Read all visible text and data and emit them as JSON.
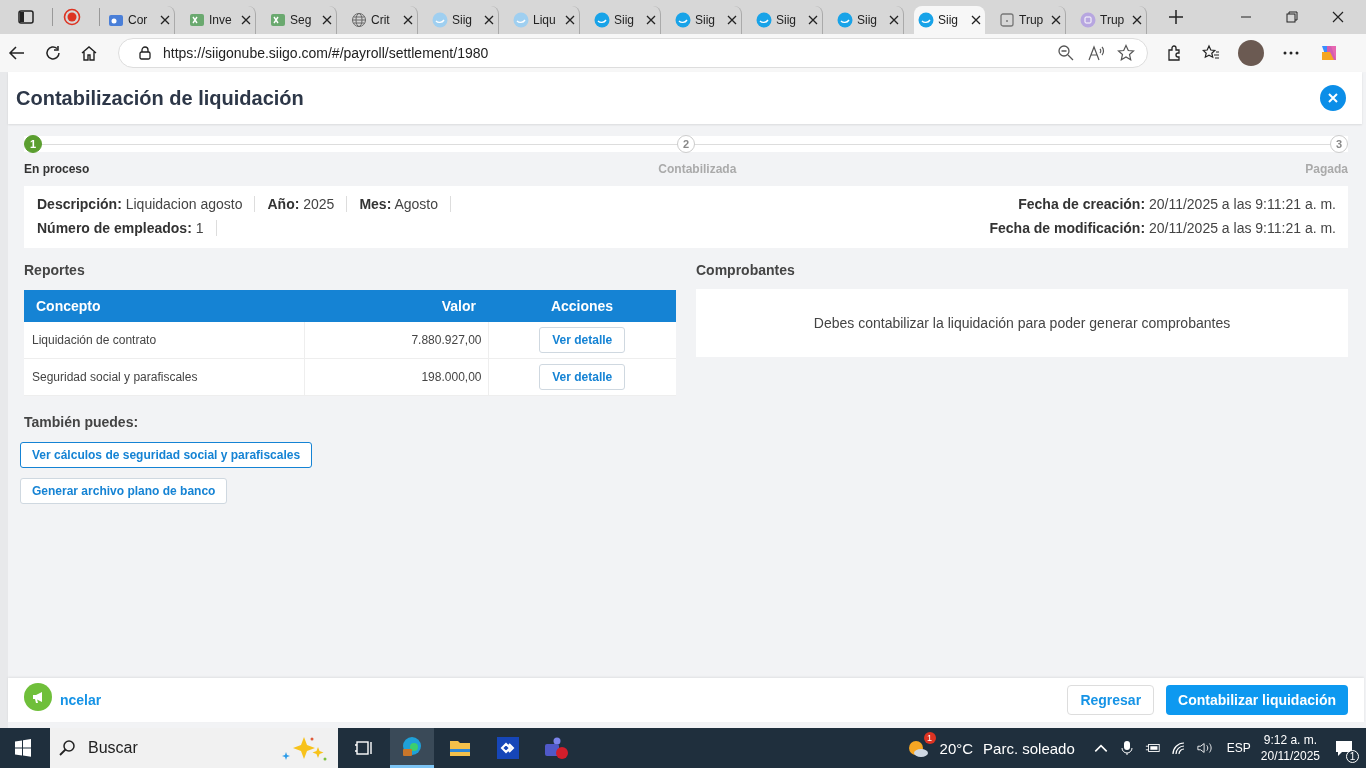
{
  "browser": {
    "tabs": [
      {
        "label": "Cor",
        "kind": "mail",
        "selected": false
      },
      {
        "label": "Inve",
        "kind": "sheet",
        "selected": false
      },
      {
        "label": "Seg",
        "kind": "sheet",
        "selected": false
      },
      {
        "label": "Crit",
        "kind": "web",
        "selected": false
      },
      {
        "label": "Siig",
        "kind": "faded",
        "selected": false
      },
      {
        "label": "Liqu",
        "kind": "faded",
        "selected": false
      },
      {
        "label": "Siig",
        "kind": "logo",
        "selected": false
      },
      {
        "label": "Siig",
        "kind": "logo",
        "selected": false
      },
      {
        "label": "Siig",
        "kind": "logo",
        "selected": false
      },
      {
        "label": "Siig",
        "kind": "logo",
        "selected": false
      },
      {
        "label": "Siig",
        "kind": "logo",
        "selected": true
      },
      {
        "label": "Trup",
        "kind": "page",
        "selected": false
      },
      {
        "label": "Trup",
        "kind": "app",
        "selected": false
      }
    ],
    "address": "https://siigonube.siigo.com/#/payroll/settlement/1980"
  },
  "page": {
    "title": "Contabilización de liquidación",
    "steps": [
      {
        "number": "1",
        "label": "En proceso",
        "active": true
      },
      {
        "number": "2",
        "label": "Contabilizada",
        "active": false
      },
      {
        "number": "3",
        "label": "Pagada",
        "active": false
      }
    ],
    "summary": {
      "left": [
        [
          {
            "label": "Descripción:",
            "value": "Liquidacion agosto"
          },
          {
            "label": "Año:",
            "value": "2025"
          },
          {
            "label": "Mes:",
            "value": "Agosto"
          }
        ],
        [
          {
            "label": "Número de empleados:",
            "value": "1"
          }
        ]
      ],
      "right": [
        {
          "label": "Fecha de creación:",
          "value": "20/11/2025 a las 9:11:21 a. m."
        },
        {
          "label": "Fecha de modificación:",
          "value": "20/11/2025 a las 9:11:21 a. m."
        }
      ]
    },
    "reports": {
      "title": "Reportes",
      "columns": [
        "Concepto",
        "Valor",
        "Acciones"
      ],
      "rows": [
        {
          "concept": "Liquidación de contrato",
          "value": "7.880.927,00",
          "action": "Ver detalle"
        },
        {
          "concept": "Seguridad social y parafiscales",
          "value": "198.000,00",
          "action": "Ver detalle"
        }
      ]
    },
    "vouchers": {
      "title": "Comprobantes",
      "message": "Debes contabilizar la liquidación para poder generar comprobantes"
    },
    "also": {
      "title": "También puedes:",
      "buttons": [
        "Ver cálculos de seguridad social y parafiscales",
        "Generar archivo plano de banco"
      ]
    },
    "footer": {
      "cancel": "ncelar",
      "back": "Regresar",
      "primary": "Contabilizar liquidación"
    }
  },
  "taskbar": {
    "search": {
      "placeholder": "Buscar"
    },
    "apps": [
      {
        "kind": "tasks",
        "selected": false
      },
      {
        "kind": "browser",
        "selected": true
      },
      {
        "kind": "folder",
        "selected": false
      },
      {
        "kind": "remote",
        "selected": false
      },
      {
        "kind": "chat",
        "selected": false
      }
    ],
    "weather": {
      "badge": "1",
      "temperature": "20°C",
      "condition": "Parc. soleado"
    },
    "language": "ESP",
    "time": "9:12 a. m.",
    "date": "20/11/2025",
    "notifications": "1"
  }
}
